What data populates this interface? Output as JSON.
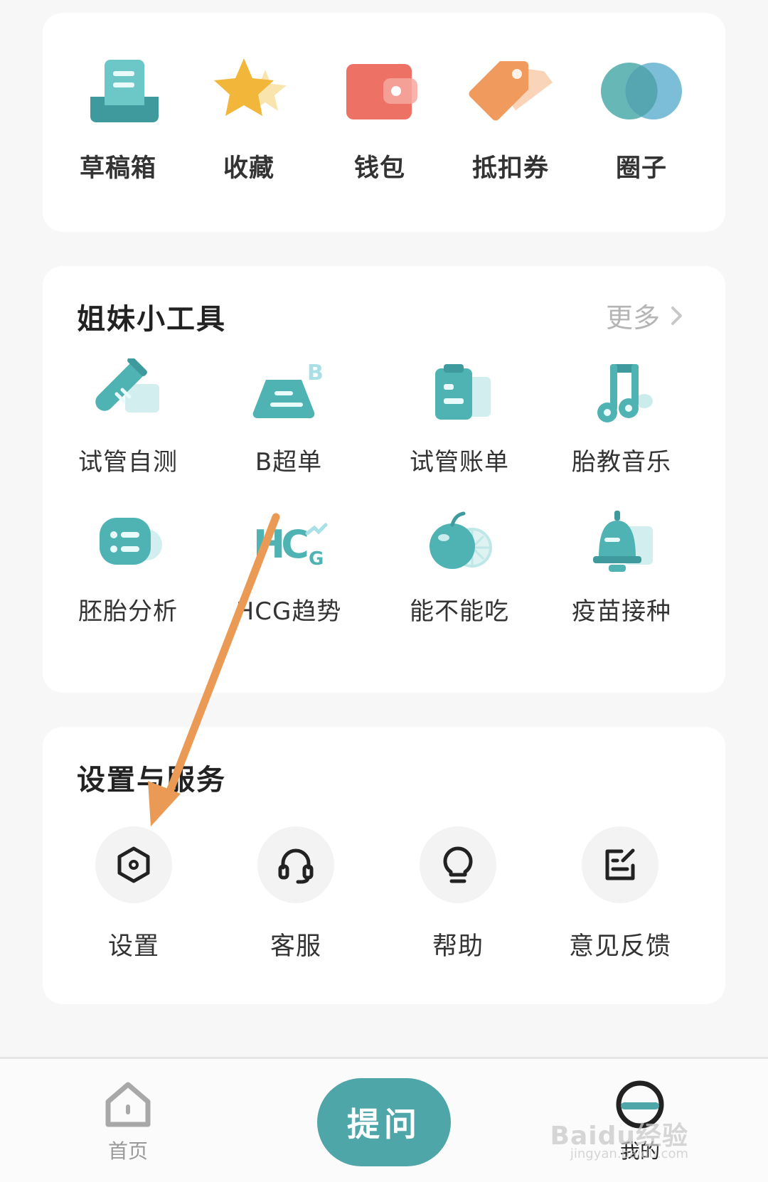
{
  "shortcuts": [
    {
      "label": "草稿箱",
      "icon": "drafts-tray-icon"
    },
    {
      "label": "收藏",
      "icon": "star-icon"
    },
    {
      "label": "钱包",
      "icon": "wallet-icon"
    },
    {
      "label": "抵扣券",
      "icon": "coupon-tag-icon"
    },
    {
      "label": "圈子",
      "icon": "circles-icon"
    }
  ],
  "tools": {
    "title": "姐妹小工具",
    "more_label": "更多",
    "items": [
      {
        "label": "试管自测",
        "icon": "test-tube-icon"
      },
      {
        "label": "B超单",
        "icon": "ultrasound-icon"
      },
      {
        "label": "试管账单",
        "icon": "clipboard-bill-icon"
      },
      {
        "label": "胎教音乐",
        "icon": "music-note-icon"
      },
      {
        "label": "胚胎分析",
        "icon": "embryo-analysis-icon"
      },
      {
        "label": "HCG趋势",
        "icon": "hcg-trend-icon"
      },
      {
        "label": "能不能吃",
        "icon": "apple-icon"
      },
      {
        "label": "疫苗接种",
        "icon": "vaccine-bell-icon"
      }
    ]
  },
  "services": {
    "title": "设置与服务",
    "items": [
      {
        "label": "设置",
        "icon": "hexagon-settings-icon"
      },
      {
        "label": "客服",
        "icon": "headset-icon"
      },
      {
        "label": "帮助",
        "icon": "lightbulb-icon"
      },
      {
        "label": "意见反馈",
        "icon": "feedback-edit-icon"
      }
    ]
  },
  "tabbar": {
    "home_label": "首页",
    "ask_label": "提问",
    "mine_label": "我的"
  },
  "watermark": {
    "text": "Baidu经验",
    "sub": "jingyan.baidu.com"
  },
  "colors": {
    "teal": "#4fa6a9",
    "arrow": "#eb9a55",
    "background": "#f7f7f7"
  }
}
